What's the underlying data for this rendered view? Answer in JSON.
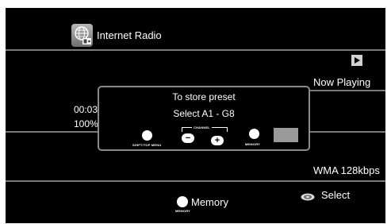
{
  "header": {
    "title": "Internet Radio",
    "radio_icon": "globe-radio-icon"
  },
  "now_playing": {
    "label": "Now Playing",
    "play_icon": "play-icon",
    "time": "00:03",
    "progress": "100%",
    "format": "WMA 128kbps"
  },
  "dialog": {
    "title": "To store preset",
    "instruction": "Select A1 - G8",
    "shift_label": "SHIFT/TOP MENU",
    "channel_label": "CHANNEL",
    "minus": "−",
    "plus": "+",
    "memory_label": "MEMORY"
  },
  "footer": {
    "memory_text": "Memory",
    "memory_small": "MEMORY",
    "select_text": "Select",
    "select_icon": "disc-select-icon"
  },
  "colors": {
    "background": "#000000",
    "line": "#7a7a7a",
    "text": "#ffffff",
    "dialog_border": "#8a8a8a"
  }
}
